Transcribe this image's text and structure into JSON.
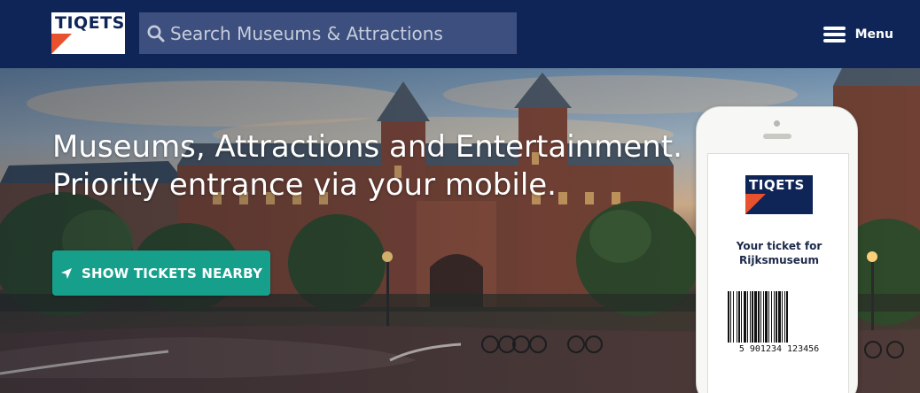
{
  "header": {
    "logo_text": "TIQETS",
    "search": {
      "placeholder": "Search Museums & Attractions"
    },
    "menu_label": "Menu",
    "icons": [
      "search-icon",
      "hamburger-icon"
    ]
  },
  "hero": {
    "headline_line1": "Museums, Attractions and Entertainment.",
    "headline_line2": "Priority entrance via your mobile.",
    "cta_label": "SHOW TICKETS NEARBY",
    "cta_icon": "location-arrow-icon"
  },
  "phone": {
    "ticket_logo_text": "TIQETS",
    "ticket_line1": "Your ticket for",
    "ticket_line2": "Rijksmuseum",
    "barcode_number": "5 901234 123456"
  },
  "colors": {
    "navy": "#0f2558",
    "search_bg": "#3d4f7e",
    "accent_orange": "#e8512e",
    "cta_teal": "#16a08c"
  }
}
